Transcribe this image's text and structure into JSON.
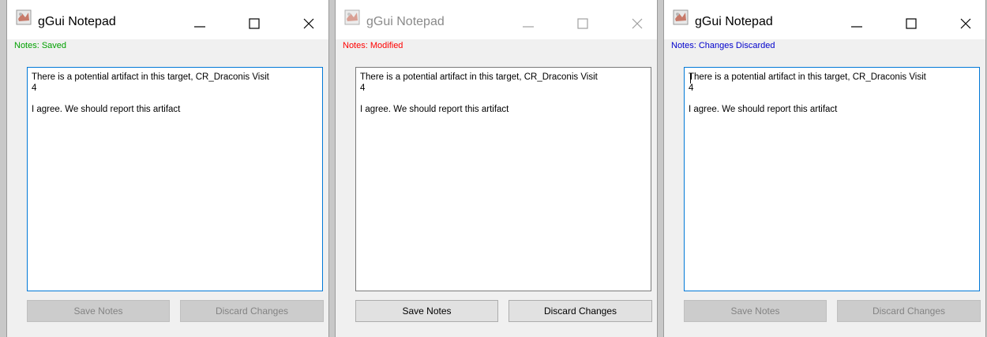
{
  "windows": [
    {
      "title": "gGui Notepad",
      "focused": true,
      "status": "Notes: Saved",
      "status_color": "#00a000",
      "notes_text": "There is a potential artifact in this target, CR_Draconis Visit\n4\n\nI agree. We should report this artifact",
      "save_label": "Save Notes",
      "discard_label": "Discard Changes",
      "buttons_enabled": false
    },
    {
      "title": "gGui Notepad",
      "focused": false,
      "status": "Notes: Modified",
      "status_color": "#ff0000",
      "notes_text": "There is a potential artifact in this target, CR_Draconis Visit\n4\n\nI agree. We should report this artifact",
      "save_label": "Save Notes",
      "discard_label": "Discard Changes",
      "buttons_enabled": true
    },
    {
      "title": "gGui Notepad",
      "focused": true,
      "status": "Notes: Changes Discarded",
      "status_color": "#0000cc",
      "notes_text": "There is a potential artifact in this target, CR_Draconis Visit\n4\n\nI agree. We should report this artifact",
      "save_label": "Save Notes",
      "discard_label": "Discard Changes",
      "buttons_enabled": false
    }
  ],
  "icons": {
    "app": "notepad-app-icon",
    "minimize": "minimize-icon",
    "maximize": "maximize-icon",
    "close": "close-icon"
  }
}
